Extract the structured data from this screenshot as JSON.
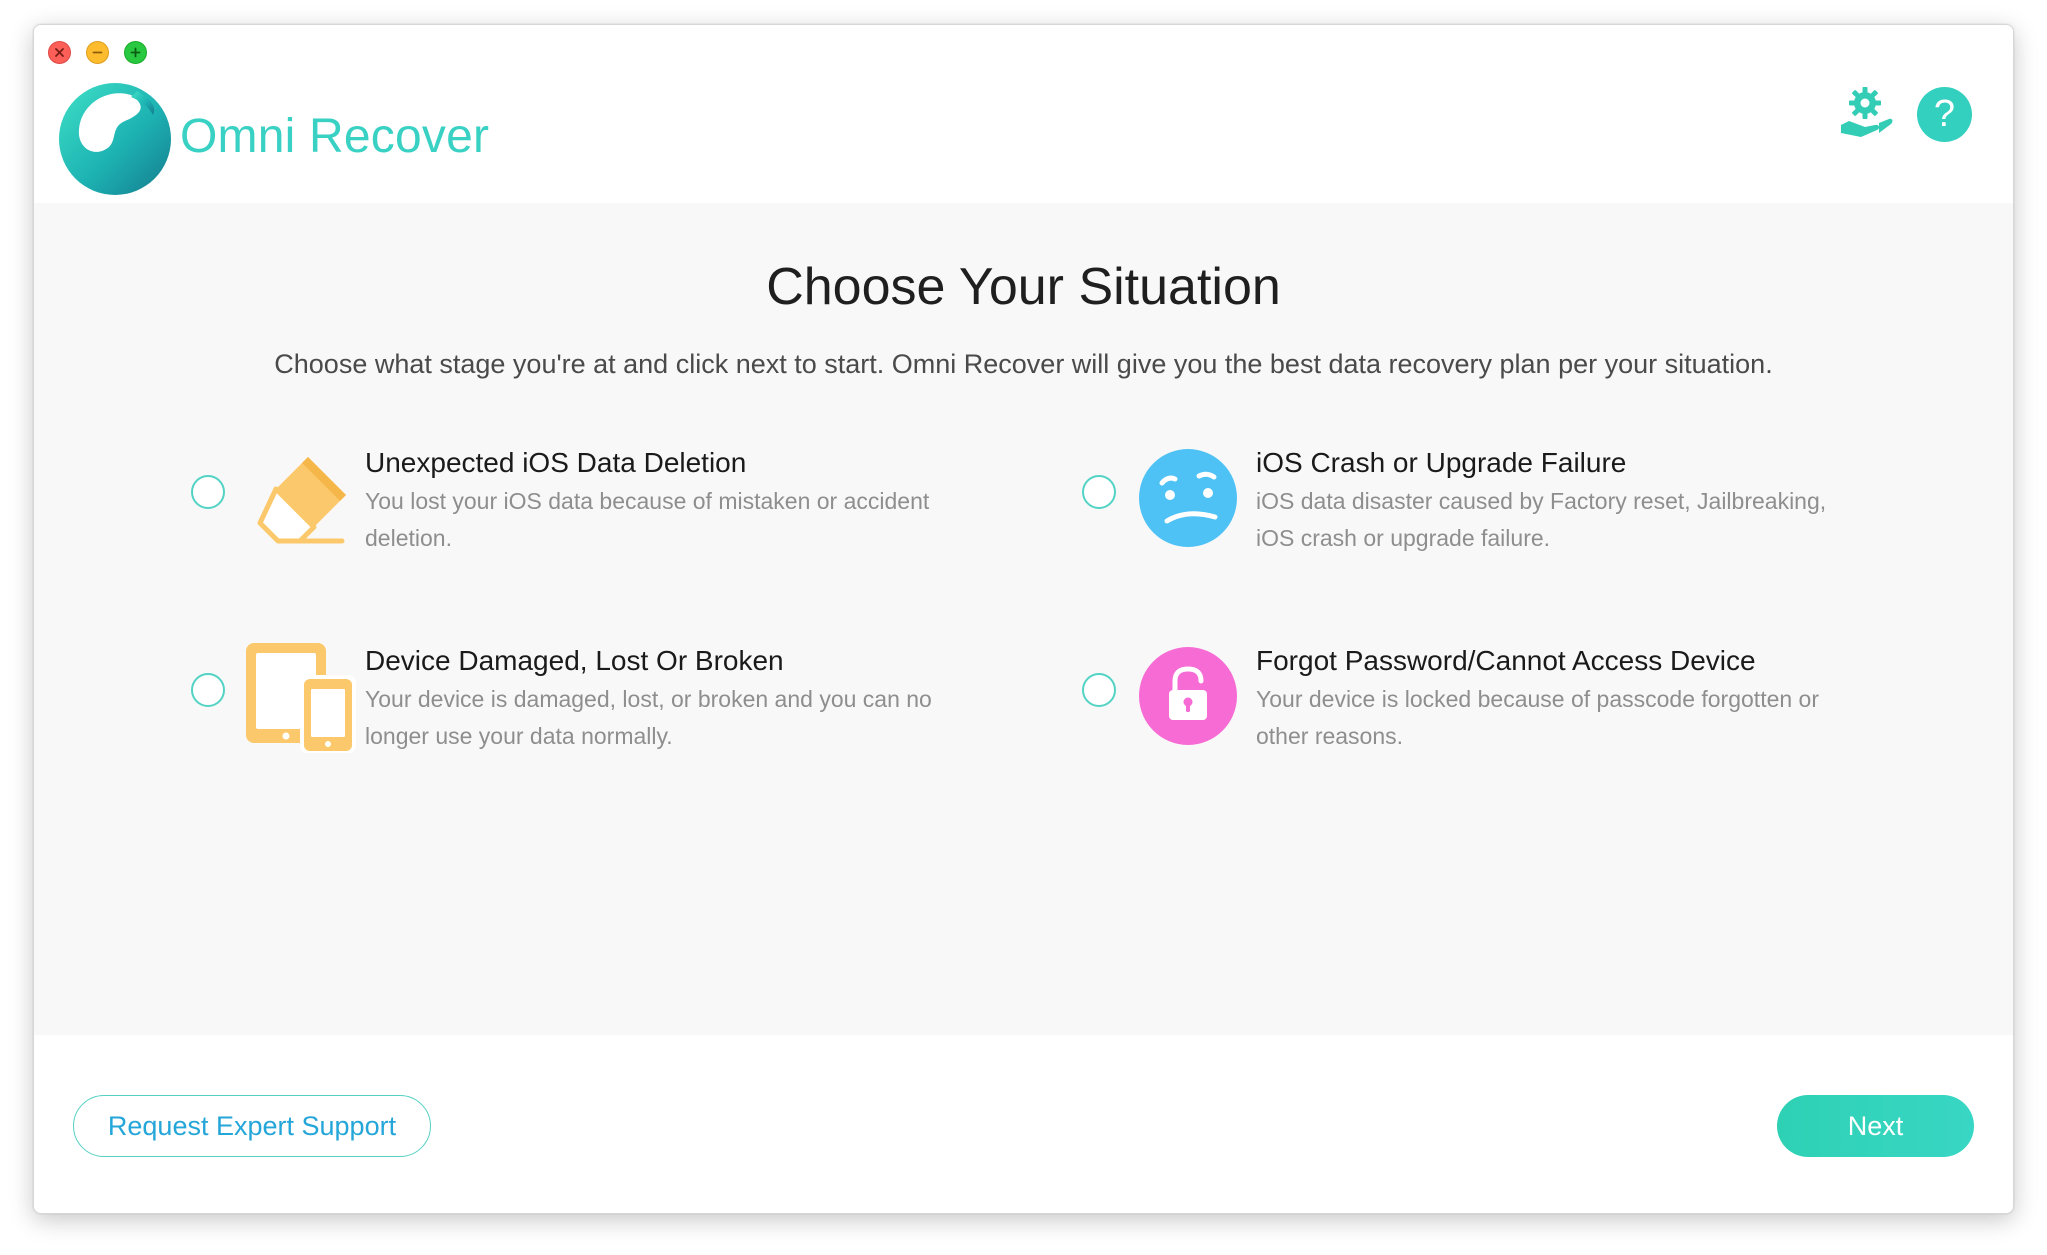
{
  "window": {
    "controls": [
      "close-icon",
      "minimize-icon",
      "maximize-icon"
    ]
  },
  "header": {
    "app_name": "Omni Recover",
    "icons": [
      "settings-hand-icon",
      "help-icon"
    ],
    "help_glyph": "?"
  },
  "main": {
    "title": "Choose Your Situation",
    "subtitle": "Choose what stage you're at and click next to start. Omni Recover will give you the best data recovery plan per your situation.",
    "options": [
      {
        "title": "Unexpected iOS Data Deletion",
        "description": "You lost your iOS data because of mistaken or accident deletion.",
        "icon": "eraser-icon",
        "selected": false
      },
      {
        "title": "iOS Crash or Upgrade Failure",
        "description": "iOS data disaster caused by Factory reset, Jailbreaking, iOS crash or upgrade failure.",
        "icon": "confused-face-icon",
        "selected": false
      },
      {
        "title": "Device Damaged, Lost Or Broken",
        "description": "Your device is damaged, lost, or broken and you can no longer use your data normally.",
        "icon": "devices-icon",
        "selected": false
      },
      {
        "title": "Forgot Password/Cannot Access Device",
        "description": "Your device is locked because of passcode forgotten or other reasons.",
        "icon": "lock-icon",
        "selected": false
      }
    ]
  },
  "footer": {
    "support_label": "Request Expert Support",
    "next_label": "Next"
  },
  "colors": {
    "accent": "#39d1c3",
    "eraser": "#fbc96b",
    "face": "#4fc2f5",
    "devices": "#fbc96b",
    "lock": "#f66bd4",
    "link": "#25a6d8"
  }
}
